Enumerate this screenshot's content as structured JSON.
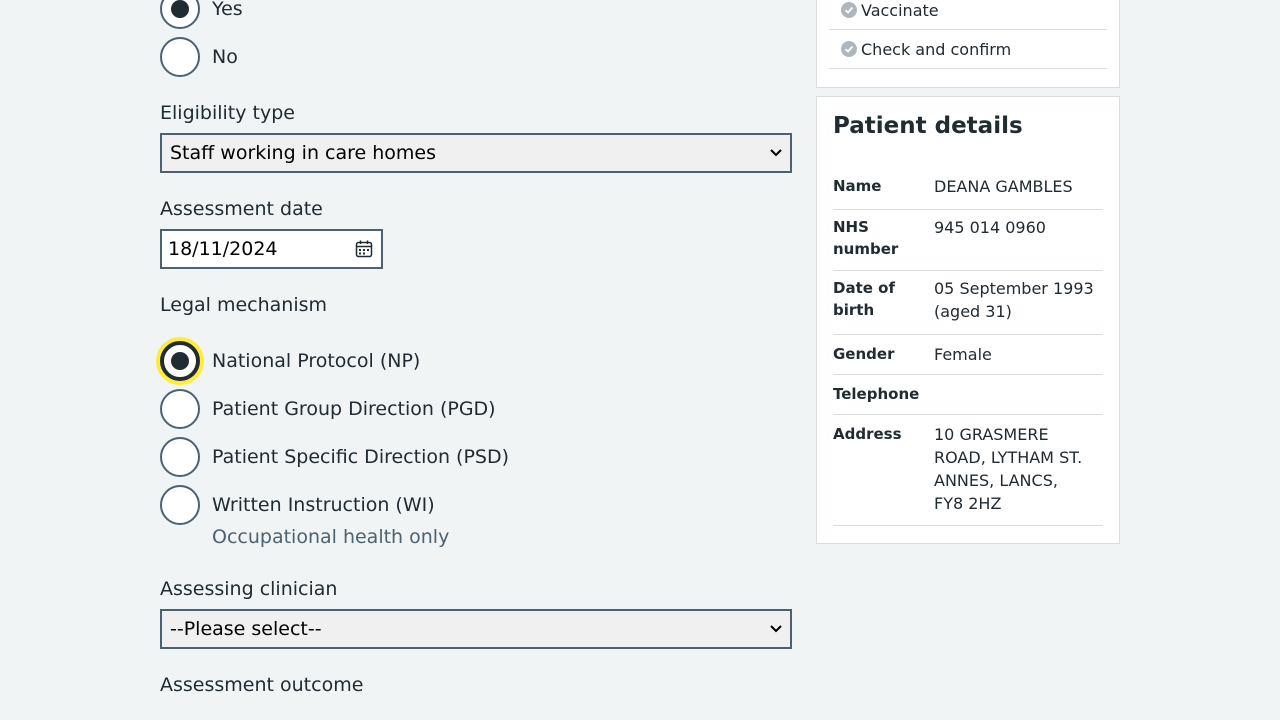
{
  "consent_radios": {
    "yes_label": "Yes",
    "no_label": "No"
  },
  "eligibility": {
    "label": "Eligibility type",
    "selected": "Staff working in care homes"
  },
  "assessment_date": {
    "label": "Assessment date",
    "value": "18/11/2024"
  },
  "legal_mechanism": {
    "label": "Legal mechanism",
    "options": [
      {
        "label": "National Protocol (NP)"
      },
      {
        "label": "Patient Group Direction (PGD)"
      },
      {
        "label": "Patient Specific Direction (PSD)"
      },
      {
        "label": "Written Instruction (WI)"
      }
    ],
    "wi_hint": "Occupational health only"
  },
  "assessing_clinician": {
    "label": "Assessing clinician",
    "selected": "--Please select--"
  },
  "assessment_outcome": {
    "label": "Assessment outcome"
  },
  "progress": {
    "items": [
      {
        "label": "Vaccinate"
      },
      {
        "label": "Check and confirm"
      }
    ]
  },
  "patient": {
    "title": "Patient details",
    "rows": [
      {
        "key": "Name",
        "value": "DEANA GAMBLES"
      },
      {
        "key": "NHS number",
        "value": "945 014 0960"
      },
      {
        "key": "Date of birth",
        "value": "05 September 1993 (aged 31)"
      },
      {
        "key": "Gender",
        "value": "Female"
      },
      {
        "key": "Telephone",
        "value": ""
      },
      {
        "key": "Address",
        "value": "10 GRASMERE ROAD, LYTHAM ST. ANNES, LANCS, FY8 2HZ"
      }
    ]
  }
}
